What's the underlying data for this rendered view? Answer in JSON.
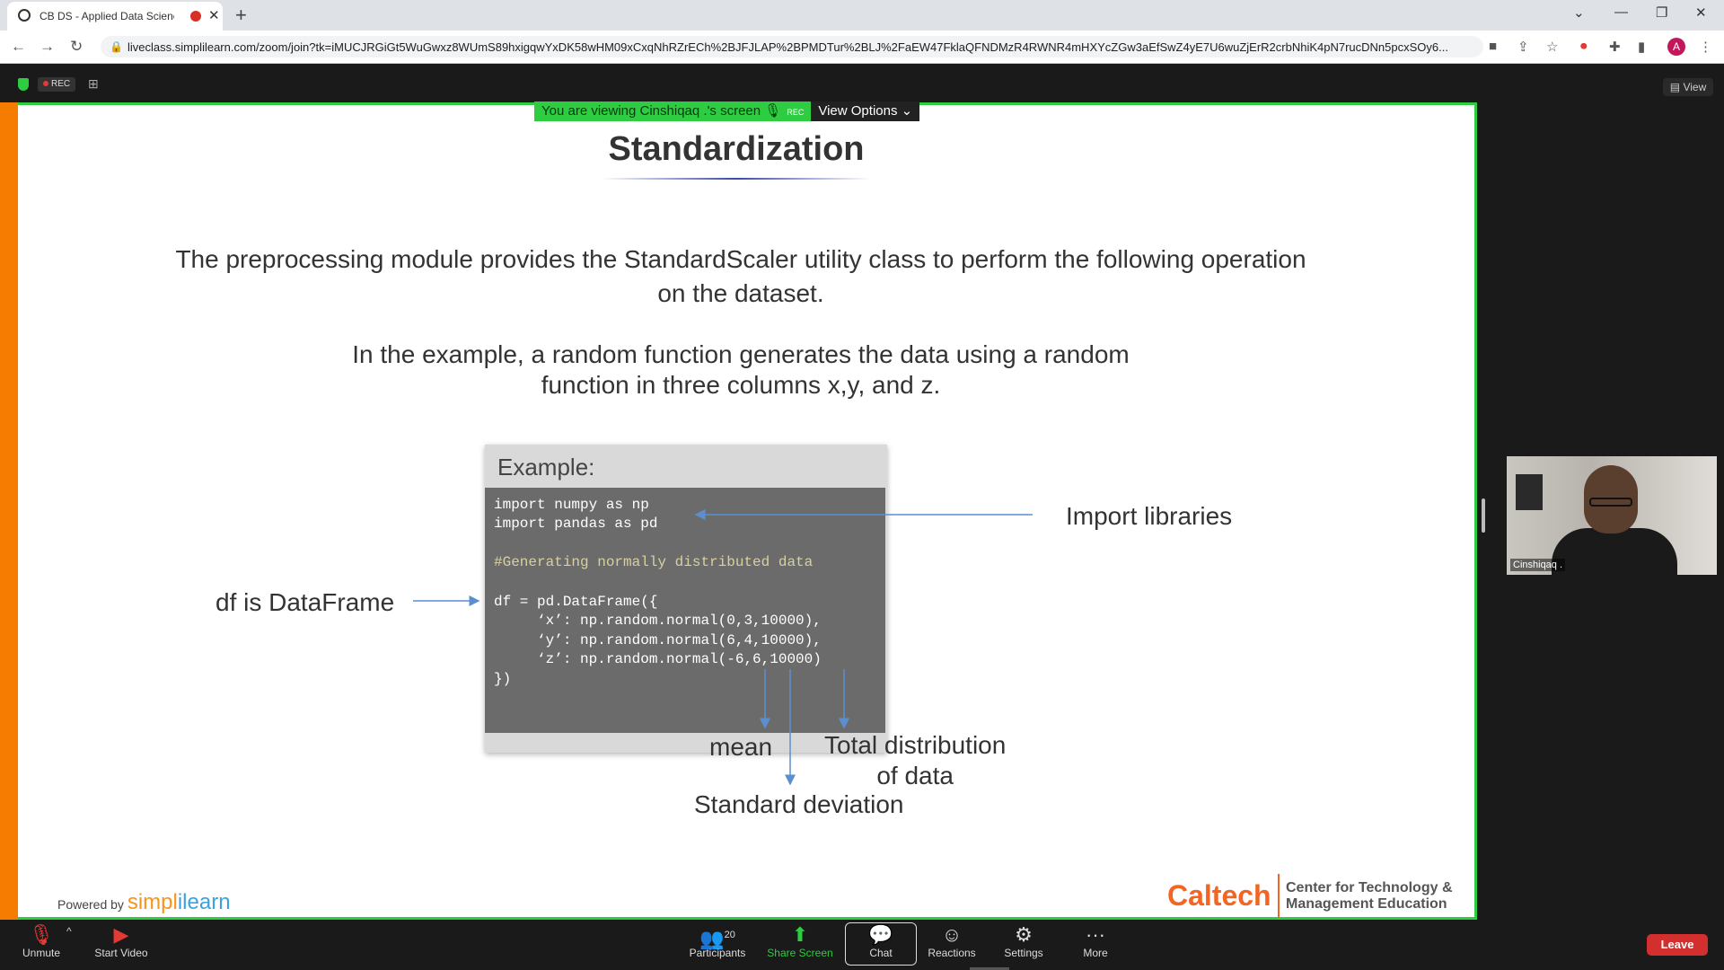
{
  "browser": {
    "tab_title": "CB DS - Applied Data Scienc",
    "url": "liveclass.simplilearn.com/zoom/join?tk=iMUCJRGiGt5WuGwxz8WUmS89hxigqwYxDK58wHM09xCxqNhRZrECh%2BJFJLAP%2BPMDTur%2BLJ%2FaEW47FklaQFNDMzR4RWNR4mHXYcZGw3aEfSwZ4yE7U6wuZjErR2crbNhiK4pN7rucDNn5pcxSOy6...",
    "avatar_letter": "A"
  },
  "zoom": {
    "rec_label": "REC",
    "view_label": "View",
    "viewing_text": "You are viewing Cinshiqaq .'s screen",
    "viewing_rec": "REC",
    "view_options": "View Options",
    "participant_name": "Cinshiqaq .",
    "participant_count": "20",
    "toolbar": {
      "unmute": "Unmute",
      "start_video": "Start Video",
      "participants": "Participants",
      "share_screen": "Share Screen",
      "chat": "Chat",
      "reactions": "Reactions",
      "settings": "Settings",
      "more": "More",
      "leave": "Leave"
    }
  },
  "slide": {
    "title": "Standardization",
    "para1": "The preprocessing module provides the StandardScaler utility class to perform the following operation on the dataset.",
    "para2_line1": "In the example, a random function generates the data using a random",
    "para2_line2": "function in three columns x,y, and z.",
    "example_label": "Example:",
    "code_lines": [
      "import numpy as np",
      "import pandas as pd",
      "",
      "#Generating normally distributed data",
      "",
      "df = pd.DataFrame({",
      "     ‘x’: np.random.normal(0,3,10000),",
      "     ‘y’: np.random.normal(6,4,10000),",
      "     ‘z’: np.random.normal(-6,6,10000)",
      "})"
    ],
    "annotations": {
      "import_libraries": "Import libraries",
      "df_dataframe": "df is DataFrame",
      "mean": "mean",
      "total_line1": "Total distribution",
      "total_line2": "of data",
      "std_dev": "Standard deviation"
    },
    "powered_by": "Powered by",
    "brand_simpl": "simpl",
    "brand_ilearn": "ilearn",
    "caltech": "Caltech",
    "ctme_line1": "Center for Technology &",
    "ctme_line2": "Management Education"
  }
}
